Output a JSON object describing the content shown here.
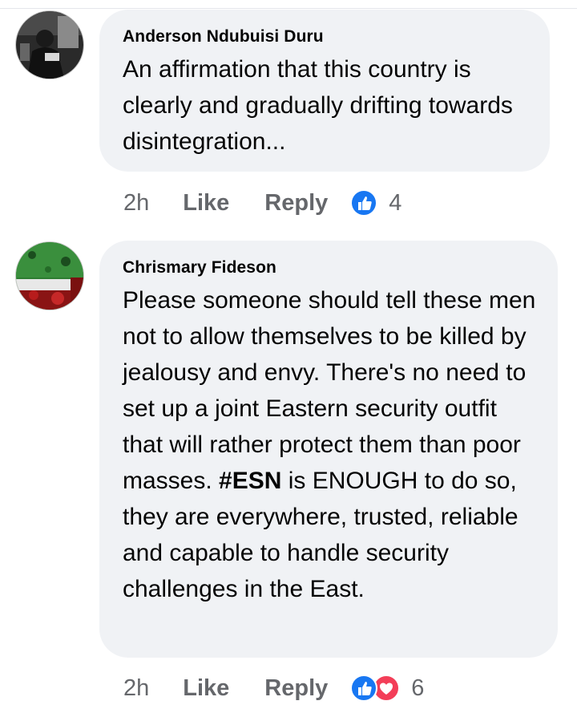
{
  "comments": [
    {
      "author": "Anderson Ndubuisi Duru",
      "text": "An affirmation that this country is clearly and gradually drifting towards disintegration...",
      "time": "2h",
      "like_label": "Like",
      "reply_label": "Reply",
      "reactions": [
        "like-icon"
      ],
      "reaction_count": "4"
    },
    {
      "author": "Chrismary Fideson",
      "text_before": "Please someone should tell these men not to allow themselves to be killed by jealousy and envy. There's no need to set up a joint Eastern security outfit that will rather protect them than poor masses. ",
      "hashtag": "#ESN",
      "text_after": " is ENOUGH to do so, they are everywhere, trusted, reliable and capable to handle security challenges in the East.",
      "time": "2h",
      "like_label": "Like",
      "reply_label": "Reply",
      "reactions": [
        "like-icon",
        "love-icon"
      ],
      "reaction_count": "6"
    }
  ],
  "colors": {
    "bubble": "#f0f2f5",
    "meta_text": "#65676b",
    "like_blue": "#1877f2",
    "love_red": "#f33e58"
  }
}
